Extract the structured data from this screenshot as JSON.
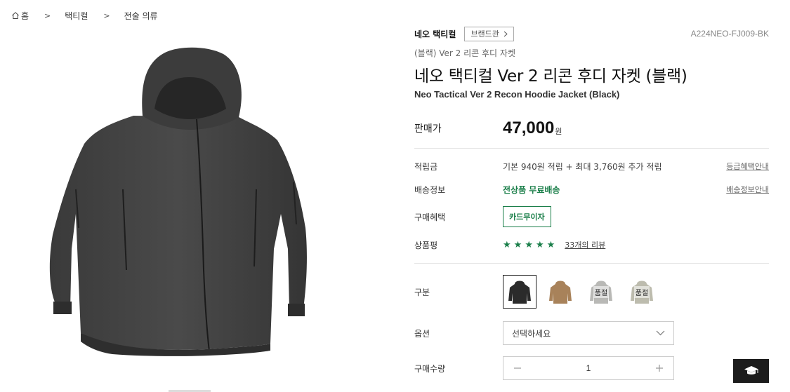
{
  "breadcrumb": {
    "home": "홈",
    "items": [
      "택티컬",
      "전술 의류"
    ],
    "separator": ">"
  },
  "product": {
    "brand": "네오 택티컬",
    "brand_hall_label": "브랜드관",
    "code": "A224NEO-FJ009-BK",
    "subtitle": "(블랙) Ver 2 리콘 후디 자켓",
    "title": "네오 택티컬 Ver 2 리콘 후디 자켓 (블랙)",
    "title_en": "Neo Tactical Ver 2 Recon Hoodie Jacket (Black)",
    "image_icon": "jacket-image"
  },
  "price": {
    "label": "판매가",
    "value": "47,000",
    "unit": "원"
  },
  "points": {
    "label": "적립금",
    "value": "기본 940원 적립 + 최대 3,760원 추가 적립",
    "link": "등급혜택안내"
  },
  "shipping": {
    "label": "배송정보",
    "value": "전상품 무료배송",
    "link": "배송정보안내"
  },
  "benefit": {
    "label": "구매혜택",
    "button": "카드무이자"
  },
  "review": {
    "label": "상품평",
    "rating": 5,
    "max_rating": 5,
    "link": "33개의 리뷰"
  },
  "variants": {
    "label": "구분",
    "items": [
      {
        "color": "#2b2b2b",
        "soldout_label": "",
        "selected": true
      },
      {
        "color": "#a8825a",
        "soldout_label": "",
        "selected": false
      },
      {
        "color": "#b9b9b6",
        "soldout_label": "품절",
        "selected": false
      },
      {
        "color": "#bdbcae",
        "soldout_label": "품절",
        "selected": false
      }
    ]
  },
  "option": {
    "label": "옵션",
    "placeholder": "선택하세요"
  },
  "quantity": {
    "label": "구매수량",
    "value": "1"
  },
  "colors": {
    "accent_green": "#1b7f4a",
    "floating_button": "#1c1c1c"
  }
}
